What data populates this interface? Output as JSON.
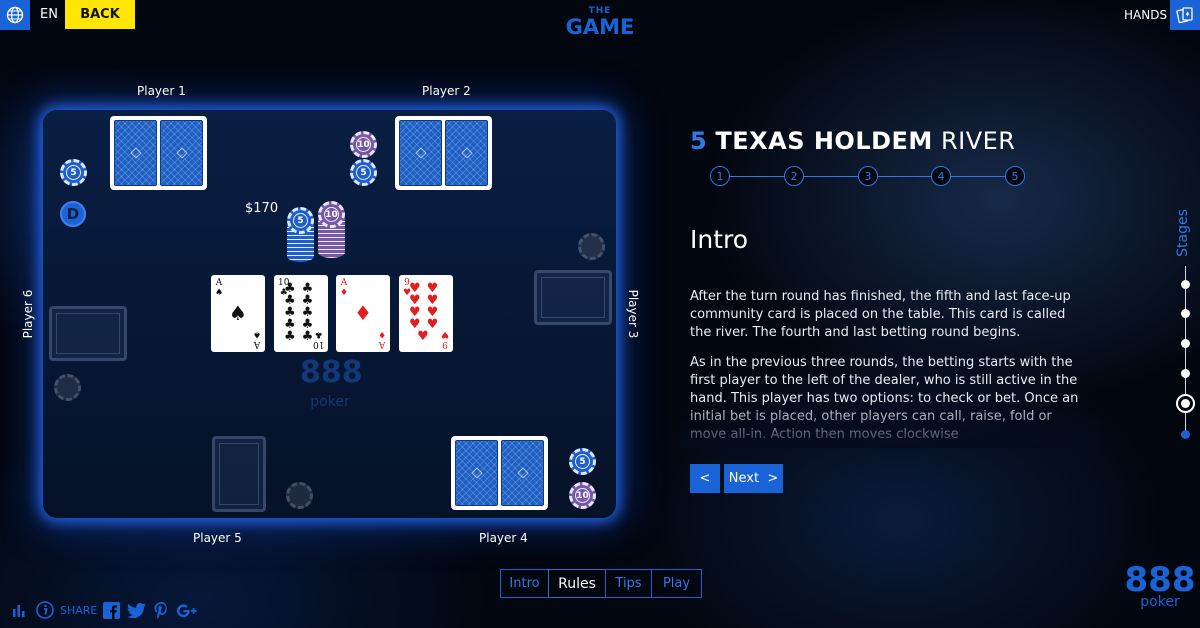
{
  "header": {
    "language": "EN",
    "back_label": "BACK",
    "logo_top": "THE",
    "logo_main": "GAME",
    "hands_label": "HANDS"
  },
  "table": {
    "players": [
      "Player 1",
      "Player 2",
      "Player 3",
      "Player 4",
      "Player 5",
      "Player 6"
    ],
    "pot": "$170",
    "dealer_button": "D",
    "chip_values": {
      "blue": "5",
      "purple": "10"
    },
    "brand_main": "888",
    "brand_sub": "poker",
    "community_cards": [
      {
        "rank": "A",
        "suit": "♠",
        "color": "#111111"
      },
      {
        "rank": "10",
        "suit": "♣",
        "color": "#111111"
      },
      {
        "rank": "A",
        "suit": "♦",
        "color": "#e02020"
      },
      {
        "rank": "9",
        "suit": "♥",
        "color": "#e02020"
      }
    ]
  },
  "stage": {
    "number": "5",
    "title_bold": "TEXAS HOLDEM",
    "title_light": "RIVER",
    "steps": [
      "1",
      "2",
      "3",
      "4",
      "5"
    ],
    "section_heading": "Intro",
    "paragraphs": [
      "After the turn round has finished, the fifth and last face-up community card is placed on the table. This card is called the river. The fourth and last betting round begins.",
      "As in the previous three rounds, the betting starts with the first player to the left of the dealer, who is still active in the hand. This player has two options: to check or bet. Once an initial bet is placed, other players can call, raise, fold or move all-in. Action then moves clockwise"
    ],
    "prev_label": "<",
    "next_label": "Next  >"
  },
  "rail": {
    "label": "Stages",
    "dot_count": 6,
    "active_index": 4
  },
  "tabs": [
    {
      "label": "Intro",
      "active": false
    },
    {
      "label": "Rules",
      "active": true
    },
    {
      "label": "Tips",
      "active": false
    },
    {
      "label": "Play",
      "active": false
    }
  ],
  "footer": {
    "share_label": "SHARE",
    "brand_main": "888",
    "brand_sub": "poker"
  },
  "colors": {
    "accent": "#1a63d6",
    "back_button": "#ffe600",
    "chip_blue": "#1f5fc9",
    "chip_purple": "#7559a8"
  },
  "icons": [
    "globe-icon",
    "hands-card-icon",
    "stats-icon",
    "info-icon",
    "facebook-icon",
    "twitter-icon",
    "pinterest-icon",
    "google-plus-icon"
  ]
}
